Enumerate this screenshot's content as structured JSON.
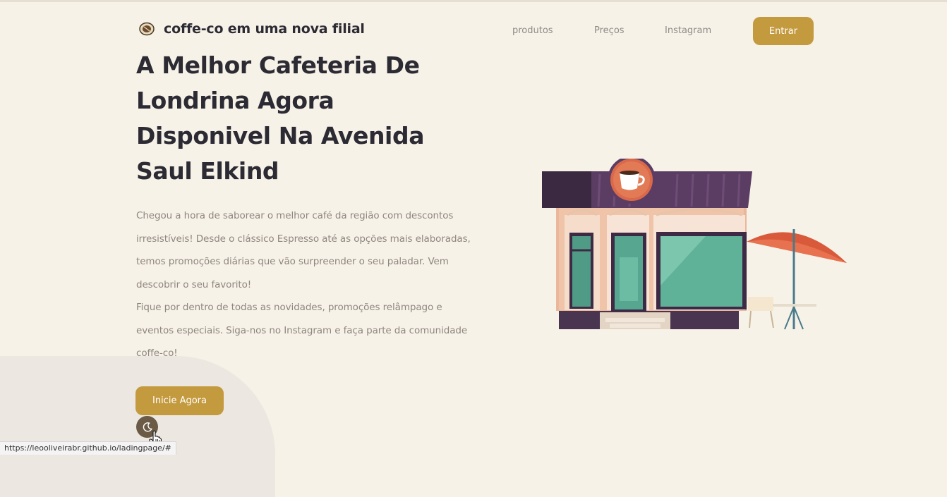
{
  "header": {
    "brand": "coffe-co em uma nova filial",
    "logo_icon": "coffee-bean-logo-icon",
    "nav": [
      {
        "label": "produtos"
      },
      {
        "label": "Preços"
      },
      {
        "label": "Instagram"
      }
    ],
    "enter_label": "Entrar"
  },
  "hero": {
    "title": "A Melhor Cafeteria De Londrina Agora Disponivel Na Avenida Saul Elkind",
    "paragraph1": "Chegou a hora de saborear o melhor café da região com descontos irresistíveis! Desde o clássico Espresso até as opções mais elaboradas, temos promoções diárias que vão surpreender o seu paladar. Vem descobrir o seu favorito!",
    "paragraph2": "Fique por dentro de todas as novidades, promoções relâmpago e eventos especiais. Siga-nos no Instagram e faça parte da comunidade coffe-co!",
    "cta_label": "Inicie Agora"
  },
  "theme_toggle_icon": "moon-icon",
  "illustration_icon": "coffee-shop-illustration",
  "status_url": "https://leooliveirabr.github.io/ladingpage/#",
  "colors": {
    "background": "#f7f2e8",
    "accent": "#c49a3e",
    "heading": "#2c2a33",
    "text": "#8e8680",
    "toggle": "#6b5a45"
  }
}
